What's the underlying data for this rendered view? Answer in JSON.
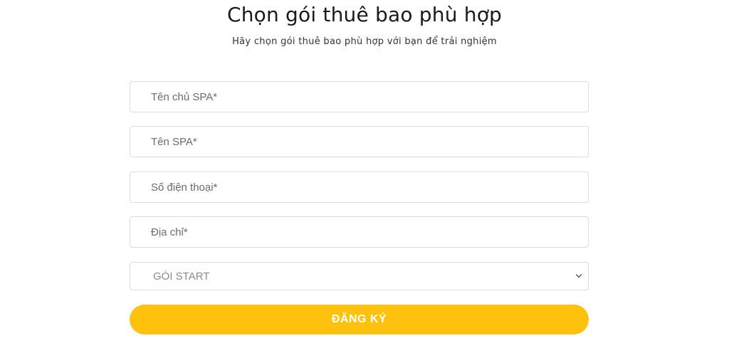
{
  "header": {
    "title": "Chọn gói thuê bao phù hợp",
    "subtitle": "Hãy chọn gói thuê bao phù hợp với bạn để trải nghiệm"
  },
  "form": {
    "owner_name": {
      "placeholder": "Tên chủ SPA*",
      "value": ""
    },
    "spa_name": {
      "placeholder": "Tên SPA*",
      "value": ""
    },
    "phone": {
      "placeholder": "Số điện thoại*",
      "value": ""
    },
    "address": {
      "placeholder": "Địa chỉ*",
      "value": ""
    },
    "package": {
      "selected": "GÓI START",
      "icon": "chevron-down-icon"
    },
    "submit_label": "ĐĂNG KÝ"
  },
  "colors": {
    "accent": "#fdc10e",
    "border": "#dcdcdc",
    "title_text": "#1a1a1a"
  }
}
